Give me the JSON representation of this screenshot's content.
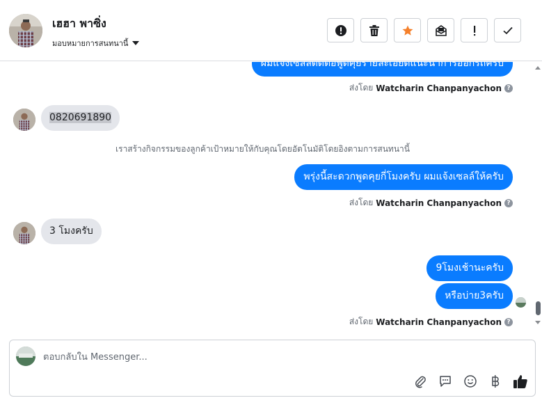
{
  "header": {
    "contact_name": "เฮฮา พาซิ่ง",
    "assign_label": "มอบหมายการสนทนานี้",
    "toolbar": [
      {
        "name": "mark-spam-button",
        "icon": "alert-circle-icon"
      },
      {
        "name": "delete-button",
        "icon": "trash-icon"
      },
      {
        "name": "star-button",
        "icon": "star-icon"
      },
      {
        "name": "mark-unread-button",
        "icon": "envelope-open-icon"
      },
      {
        "name": "follow-up-button",
        "icon": "exclamation-icon"
      },
      {
        "name": "mark-done-button",
        "icon": "checkmark-icon"
      }
    ]
  },
  "messages": {
    "out_1": "ผมแจ้งเซลล์ติดต่อพูดคุยรายละเอียดแนะนำการออกรถครับ",
    "sent_by_prefix": "ส่งโดย",
    "sent_by_name": "Watcharin Chanpanyachon",
    "in_1": "0820691890",
    "system_note": "เราสร้างกิจกรรมของลูกค้าเป้าหมายให้กับคุณโดยอัตโนมัติโดยอิงตามการสนทนานี้",
    "out_2": "พรุ่งนี้สะดวกพูดคุยกี่โมงครับ ผมแจ้งเซลล์ให้ครับ",
    "in_2": "3 โมงครับ",
    "out_3": "9โมงเช้านะครับ",
    "out_4": "หรือบ่าย3ครับ"
  },
  "composer": {
    "placeholder": "ตอบกลับใน Messenger...",
    "icons": [
      "paperclip-icon",
      "saved-reply-icon",
      "emoji-icon",
      "baht-payment-icon",
      "thumbs-up-icon"
    ]
  },
  "colors": {
    "outgoing_bubble": "#0a7cff",
    "incoming_bubble": "#e4e6eb",
    "star_accent": "#f5802b"
  }
}
